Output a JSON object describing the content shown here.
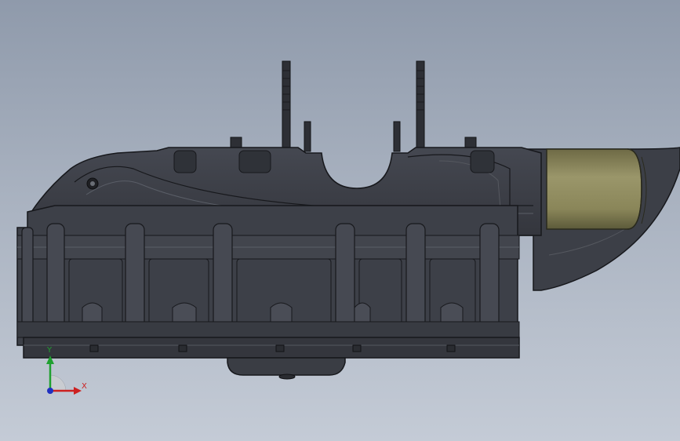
{
  "viewport": {
    "background_top": "#8f9aab",
    "background_bottom": "#c4cbd6"
  },
  "model": {
    "body_color": "#3a3d44",
    "edge_color": "#17181c",
    "highlight_color": "#5a5e67",
    "cylinder_color": "#878359"
  },
  "triad": {
    "x_label": "X",
    "y_label": "Y",
    "x_color": "#cc2020",
    "y_color": "#1fa030",
    "z_color": "#2030c0"
  }
}
